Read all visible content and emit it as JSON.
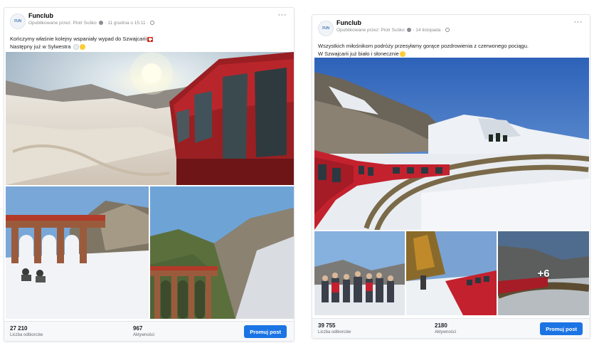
{
  "posts": [
    {
      "page_name": "Funclub",
      "published_by": "Opublikowane przez: Piotr Suško",
      "date": "11 grudnia o 15:11",
      "caption_line1": "Kończymy właśnie kolejny wspaniały wypad do Szwajcarii",
      "caption_line2": "Następny już w Sylwestra",
      "reach_value": "27 210",
      "reach_label": "Liczba odbiorców",
      "engagement_value": "967",
      "engagement_label": "Aktywności",
      "promote_label": "Promuj post",
      "more_label": "···"
    },
    {
      "page_name": "Funclub",
      "published_by": "Opublikowane przez: Piotr Suško",
      "date": "14 listopada",
      "caption_line1": "Wszystkich miłośnikom podróży przesyłamy gorące pozdrowienia z czerwonego pociągu.",
      "caption_line2": "W Szwajcarii już biało i słonecznie",
      "photo_overlay": "+6",
      "reach_value": "39 755",
      "reach_label": "Liczba odbiorców",
      "engagement_value": "2180",
      "engagement_label": "Aktywności",
      "promote_label": "Promuj post",
      "more_label": "···"
    }
  ],
  "colors": {
    "promote_button": "#1b74e4",
    "train_red": "#c4212e",
    "sky": "#5b8fd6"
  }
}
